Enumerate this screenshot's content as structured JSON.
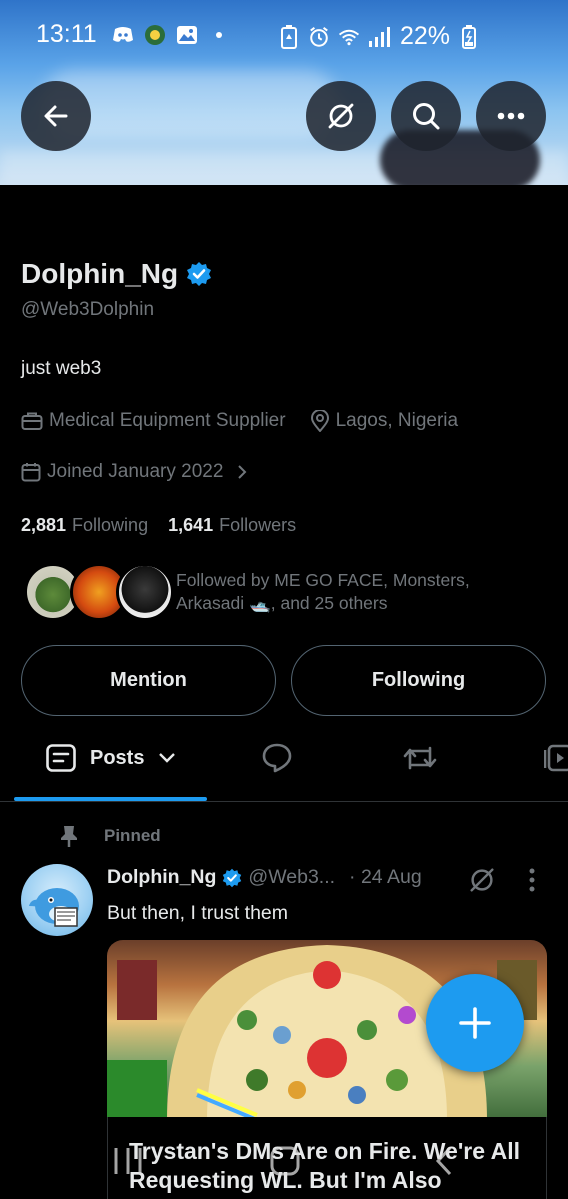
{
  "status_bar": {
    "time": "13:11",
    "battery": "22%",
    "left_icons": [
      "discord-icon",
      "app-notification-icon",
      "gallery-icon",
      "dot-icon"
    ],
    "right_icons": [
      "battery-saver-icon",
      "alarm-icon",
      "wifi-icon",
      "signal-icon",
      "battery-charging-icon"
    ]
  },
  "header": {
    "back_icon": "arrow-left-icon",
    "actions": [
      "grok-icon",
      "search-icon",
      "more-icon"
    ]
  },
  "profile": {
    "name": "Dolphin_Ng",
    "verified": true,
    "handle": "@Web3Dolphin",
    "bio": "just web3",
    "profession": "Medical Equipment Supplier",
    "location": "Lagos, Nigeria",
    "joined": "Joined January 2022",
    "following_count": "2,881",
    "following_label": "Following",
    "followers_count": "1,641",
    "followers_label": "Followers",
    "followed_by": "Followed by ME GO FACE, Monsters, Arkasadi 🛥️, and 25 others"
  },
  "buttons": {
    "mention": "Mention",
    "following": "Following"
  },
  "tabs": {
    "active": "Posts"
  },
  "post": {
    "pinned_label": "Pinned",
    "author_name": "Dolphin_Ng",
    "author_handle": "@Web3...",
    "date": "· 24 Aug",
    "text": "But then, I trust them",
    "card_title": "Trystan's DMs Are on Fire. We're All Requesting WL. But I'm Also"
  },
  "colors": {
    "accent": "#1d9bf0",
    "background": "#000000",
    "muted_text": "#71767b",
    "primary_text": "#e7e9ea"
  }
}
